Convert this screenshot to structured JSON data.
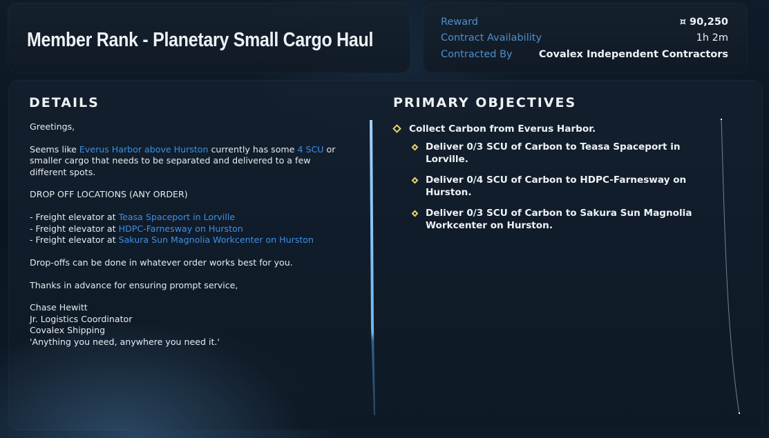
{
  "header": {
    "contract_title": "Member Rank - Planetary Small Cargo Haul"
  },
  "reward_panel": {
    "reward_label": "Reward",
    "reward_value": "¤ 90,250",
    "availability_label": "Contract Availability",
    "availability_value": "1h 2m",
    "contracted_by_label": "Contracted By",
    "contracted_by_value": "Covalex Independent Contractors"
  },
  "details": {
    "heading": "DETAILS",
    "greeting": "Greetings,",
    "intro_1": "Seems like ",
    "intro_link_location": "Everus Harbor above Hurston",
    "intro_2": " currently has some ",
    "intro_link_amount": "4 SCU",
    "intro_3": " or smaller cargo that needs to be separated and delivered to a few different spots.",
    "dropoff_heading": "DROP OFF LOCATIONS (ANY ORDER)",
    "dropoffs": [
      {
        "prefix": "- Freight elevator at ",
        "link": "Teasa Spaceport in Lorville"
      },
      {
        "prefix": "- Freight elevator at ",
        "link": "HDPC-Farnesway on Hurston"
      },
      {
        "prefix": "- Freight elevator at ",
        "link": "Sakura Sun Magnolia Workcenter on Hurston"
      }
    ],
    "order_note": "Drop-offs can be done in whatever order works best for you.",
    "thanks": "Thanks in advance for ensuring prompt service,",
    "signature": {
      "name": "Chase Hewitt",
      "role": "Jr. Logistics Coordinator",
      "company": "Covalex Shipping",
      "motto": "'Anything you need, anywhere you need it.'"
    }
  },
  "objectives": {
    "heading": "PRIMARY OBJECTIVES",
    "main": "Collect Carbon from Everus Harbor.",
    "subs": [
      "Deliver 0/3 SCU of Carbon to Teasa Spaceport in Lorville.",
      "Deliver 0/4 SCU of Carbon to HDPC-Farnesway on Hurston.",
      "Deliver 0/3 SCU of Carbon to Sakura Sun Magnolia Workcenter on Hurston."
    ]
  },
  "colors": {
    "accent_link": "#3d8fe6",
    "label_blue": "#4f8fc9",
    "objective_diamond": "#e8d468",
    "panel_bg": "#16212e"
  }
}
